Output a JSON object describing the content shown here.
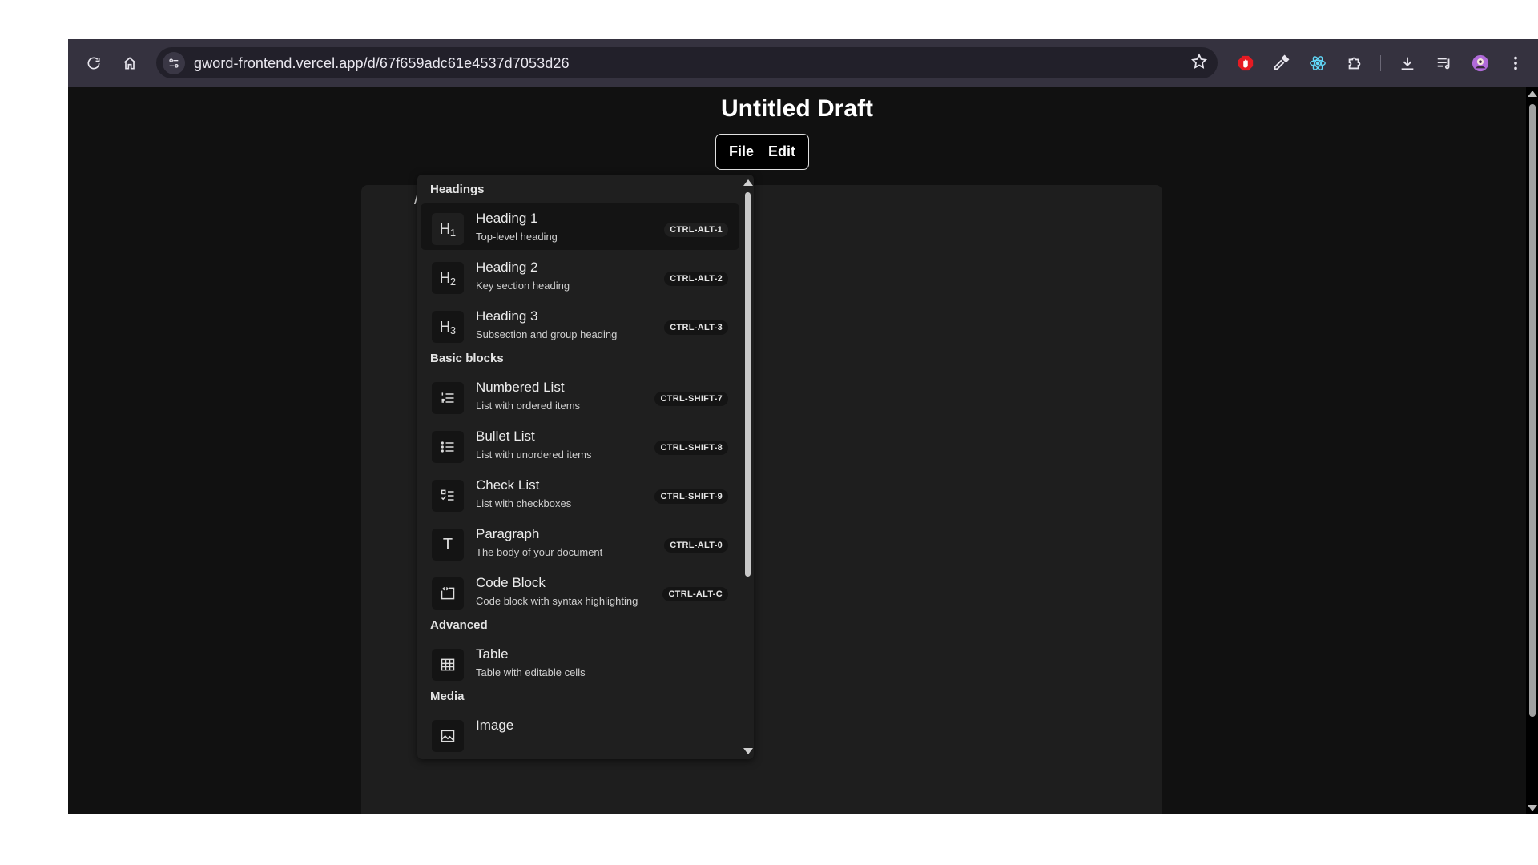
{
  "browser": {
    "url": "gword-frontend.vercel.app/d/67f659adc61e4537d7053d26",
    "extensions": [
      "adblock-icon",
      "color-picker-icon",
      "react-devtools-icon",
      "extensions-puzzle-icon"
    ],
    "toolbar_icons": [
      "reload-icon",
      "home-icon",
      "downloads-icon",
      "media-queue-icon",
      "profile-avatar",
      "kebab-menu-icon"
    ]
  },
  "document": {
    "title": "Untitled Draft",
    "menu": {
      "file": "File",
      "edit": "Edit"
    },
    "editor_text": "/"
  },
  "slash_menu": {
    "groups": [
      {
        "label": "Headings",
        "items": [
          {
            "title": "Heading 1",
            "subtitle": "Top-level heading",
            "shortcut": "CTRL-ALT-1",
            "icon": "heading-1-icon",
            "glyph": "H1",
            "active": true
          },
          {
            "title": "Heading 2",
            "subtitle": "Key section heading",
            "shortcut": "CTRL-ALT-2",
            "icon": "heading-2-icon",
            "glyph": "H2"
          },
          {
            "title": "Heading 3",
            "subtitle": "Subsection and group heading",
            "shortcut": "CTRL-ALT-3",
            "icon": "heading-3-icon",
            "glyph": "H3"
          }
        ]
      },
      {
        "label": "Basic blocks",
        "items": [
          {
            "title": "Numbered List",
            "subtitle": "List with ordered items",
            "shortcut": "CTRL-SHIFT-7",
            "icon": "numbered-list-icon"
          },
          {
            "title": "Bullet List",
            "subtitle": "List with unordered items",
            "shortcut": "CTRL-SHIFT-8",
            "icon": "bullet-list-icon"
          },
          {
            "title": "Check List",
            "subtitle": "List with checkboxes",
            "shortcut": "CTRL-SHIFT-9",
            "icon": "check-list-icon"
          },
          {
            "title": "Paragraph",
            "subtitle": "The body of your document",
            "shortcut": "CTRL-ALT-0",
            "icon": "paragraph-icon",
            "glyph": "T"
          },
          {
            "title": "Code Block",
            "subtitle": "Code block with syntax highlighting",
            "shortcut": "CTRL-ALT-C",
            "icon": "code-block-icon"
          }
        ]
      },
      {
        "label": "Advanced",
        "items": [
          {
            "title": "Table",
            "subtitle": "Table with editable cells",
            "icon": "table-icon"
          }
        ]
      },
      {
        "label": "Media",
        "items": [
          {
            "title": "Image",
            "icon": "image-icon"
          }
        ]
      }
    ]
  },
  "colors": {
    "toolbar_bg": "#35323f",
    "page_bg": "#111111",
    "editor_bg": "#1e1e1e",
    "menu_bg": "#1f1f1f",
    "adblock_red": "#e51b23",
    "react_blue": "#61dafb",
    "avatar_purple": "#b06ad9"
  }
}
